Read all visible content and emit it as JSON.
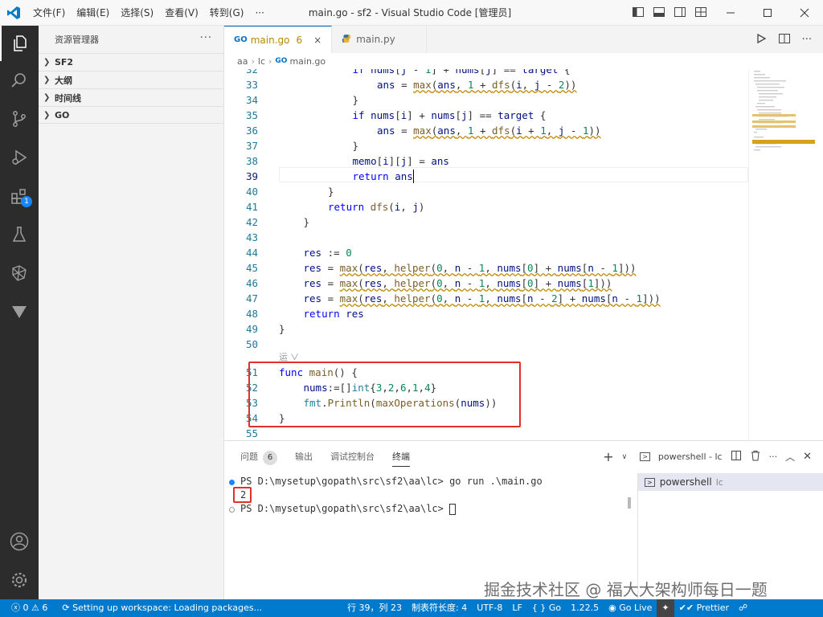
{
  "menu": [
    "文件(F)",
    "编辑(E)",
    "选择(S)",
    "查看(V)",
    "转到(G)",
    "···"
  ],
  "window_title": "main.go - sf2 - Visual Studio Code [管理员]",
  "activity_badge": "1",
  "sidebar": {
    "title": "资源管理器",
    "more": "···",
    "sections": [
      "SF2",
      "大纲",
      "时间线",
      "GO"
    ]
  },
  "tabs": [
    {
      "icon": "GO",
      "name": "main.go",
      "count": "6",
      "close": "×"
    },
    {
      "name": "main.py"
    }
  ],
  "breadcrumb": [
    "aa",
    "lc",
    "main.go"
  ],
  "breadcrumb_icon": "GO",
  "editor": {
    "codelens": "运 ∨",
    "lines": [
      {
        "n": "32",
        "t": "if nums[j - 1] + nums[j] == target {"
      },
      {
        "n": "33",
        "t": "ans = max(ans, 1 + dfs(i, j - 2))"
      },
      {
        "n": "34",
        "t": "}"
      },
      {
        "n": "35",
        "t": "if nums[i] + nums[j] == target {"
      },
      {
        "n": "36",
        "t": "ans = max(ans, 1 + dfs(i + 1, j - 1))"
      },
      {
        "n": "37",
        "t": "}"
      },
      {
        "n": "38",
        "t": "memo[i][j] = ans"
      },
      {
        "n": "39",
        "t": "return ans"
      },
      {
        "n": "40",
        "t": "}"
      },
      {
        "n": "41",
        "t": "return dfs(i, j)"
      },
      {
        "n": "42",
        "t": "}"
      },
      {
        "n": "43",
        "t": ""
      },
      {
        "n": "44",
        "t": "res := 0"
      },
      {
        "n": "45",
        "t": "res = max(res, helper(0, n - 1, nums[0] + nums[n - 1]))"
      },
      {
        "n": "46",
        "t": "res = max(res, helper(0, n - 1, nums[0] + nums[1]))"
      },
      {
        "n": "47",
        "t": "res = max(res, helper(0, n - 1, nums[n - 2] + nums[n - 1]))"
      },
      {
        "n": "48",
        "t": "return res"
      },
      {
        "n": "49",
        "t": "}"
      },
      {
        "n": "50",
        "t": ""
      },
      {
        "n": "51",
        "t": "func main() {"
      },
      {
        "n": "52",
        "t": "nums:=[]int{3,2,6,1,4}"
      },
      {
        "n": "53",
        "t": "fmt.Println(maxOperations(nums))"
      },
      {
        "n": "54",
        "t": "}"
      },
      {
        "n": "55",
        "t": ""
      }
    ]
  },
  "panel": {
    "tabs": [
      "问题",
      "输出",
      "调试控制台",
      "终端"
    ],
    "problems_count": "6",
    "terminal_name": "powershell - lc",
    "list_item": "powershell",
    "list_item_sub": "lc",
    "terminal_lines": [
      "PS D:\\mysetup\\gopath\\src\\sf2\\aa\\lc> go run .\\main.go",
      "2",
      "PS D:\\mysetup\\gopath\\src\\sf2\\aa\\lc> "
    ]
  },
  "status": {
    "errors": "0",
    "warnings": "6",
    "workspace": "Setting up workspace: Loading packages...",
    "position": "行 39，列 23",
    "tabsize": "制表符长度: 4",
    "encoding": "UTF-8",
    "eol": "LF",
    "lang": "Go",
    "version": "1.22.5",
    "golive": "Go Live",
    "prettier": "Prettier"
  },
  "watermark": "掘金技术社区 @ 福大大架构师每日一题"
}
